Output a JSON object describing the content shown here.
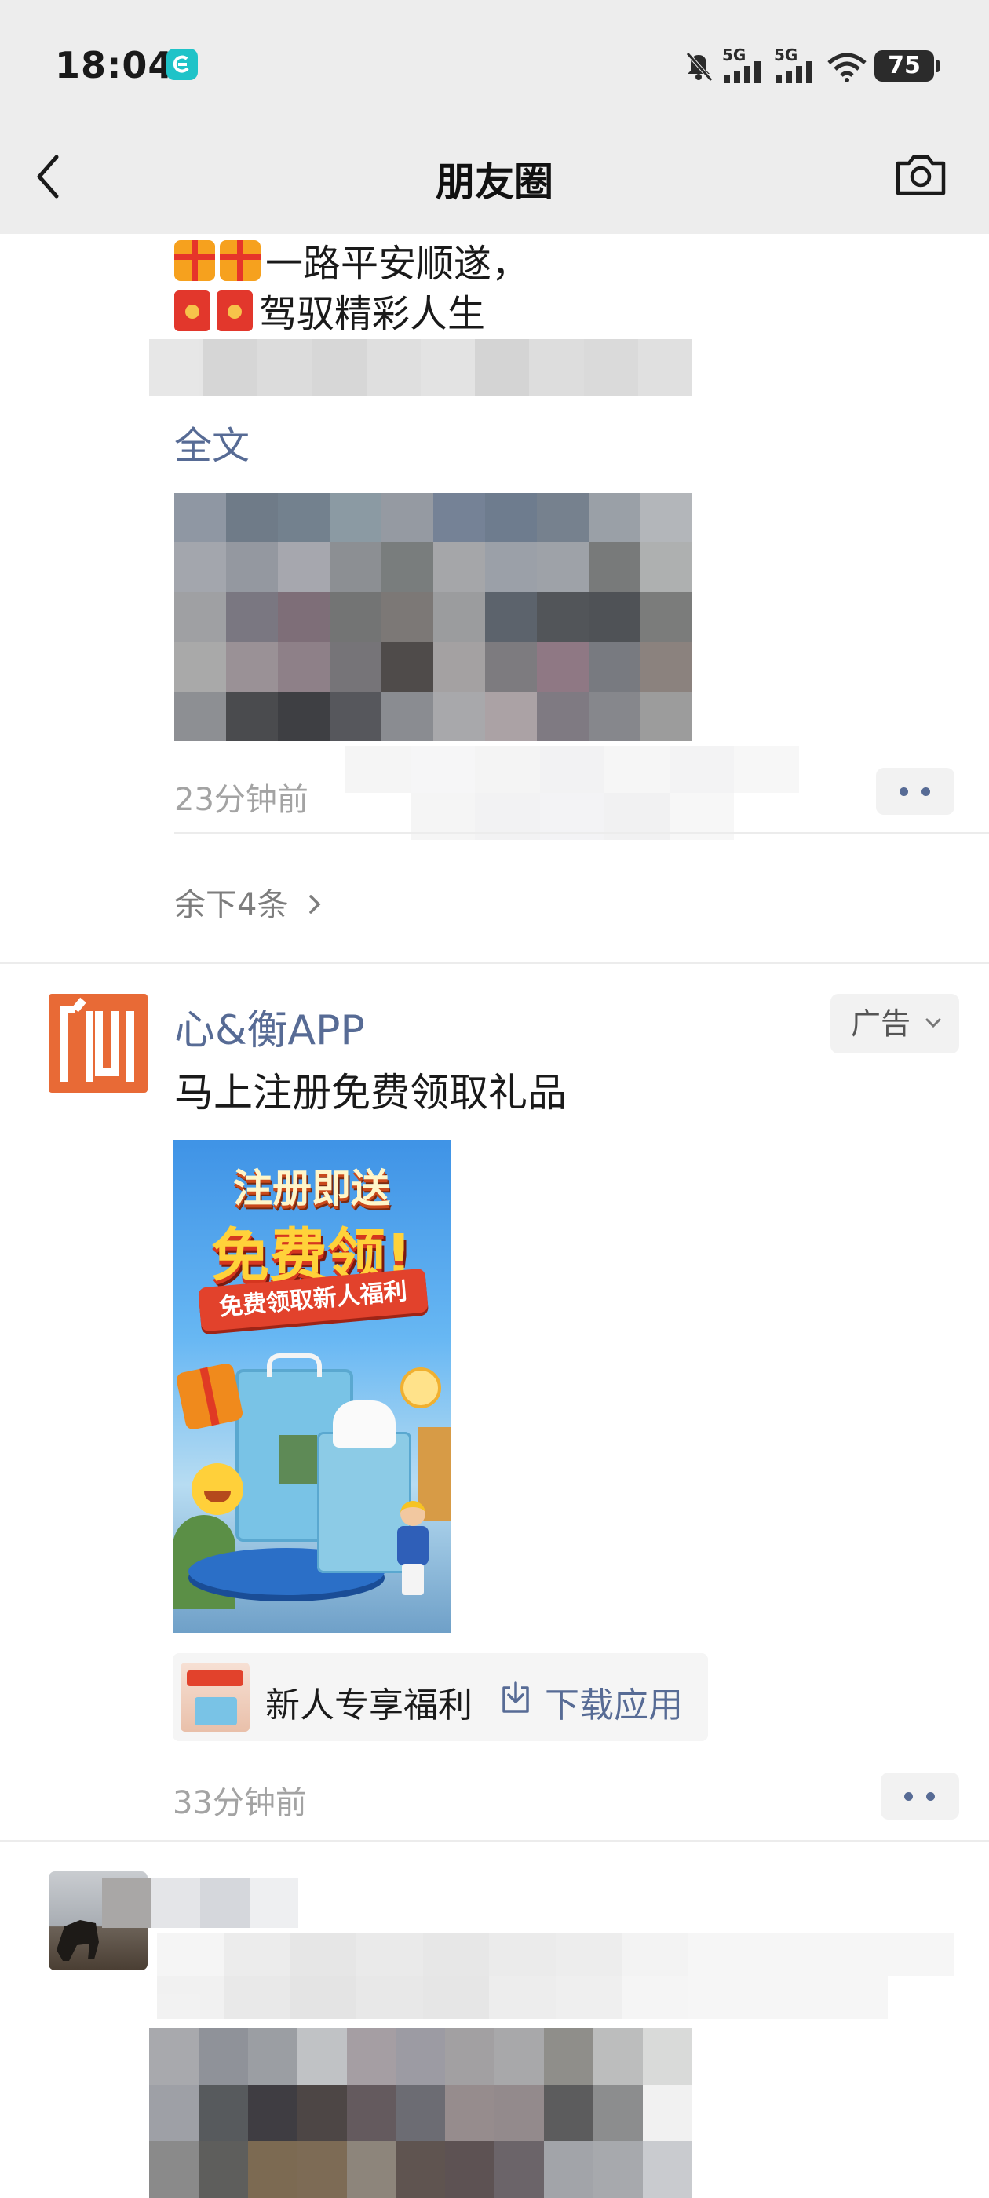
{
  "status_bar": {
    "time": "18:04",
    "battery": "75",
    "signal_1": "5G",
    "signal_2": "5G"
  },
  "nav": {
    "title": "朋友圈",
    "back_icon": "chevron-left-icon",
    "camera_icon": "camera-icon"
  },
  "post1": {
    "line1": "一路平安顺遂，",
    "line2": "驾驭精彩人生",
    "full_text_link": "全文",
    "time": "23分钟前",
    "more_comments": "余下4条"
  },
  "ad": {
    "name": "心&衡APP",
    "tag": "广告",
    "description": "马上注册免费领取礼品",
    "image_headline_1": "注册即送",
    "image_headline_2": "免费领!",
    "image_ribbon": "免费领取新人福利",
    "strip_text": "新人专享福利",
    "download_label": "下载应用",
    "time": "33分钟前"
  },
  "colors": {
    "link": "#576b95",
    "topbar": "#ededed",
    "ad_logo": "#e86a36"
  }
}
